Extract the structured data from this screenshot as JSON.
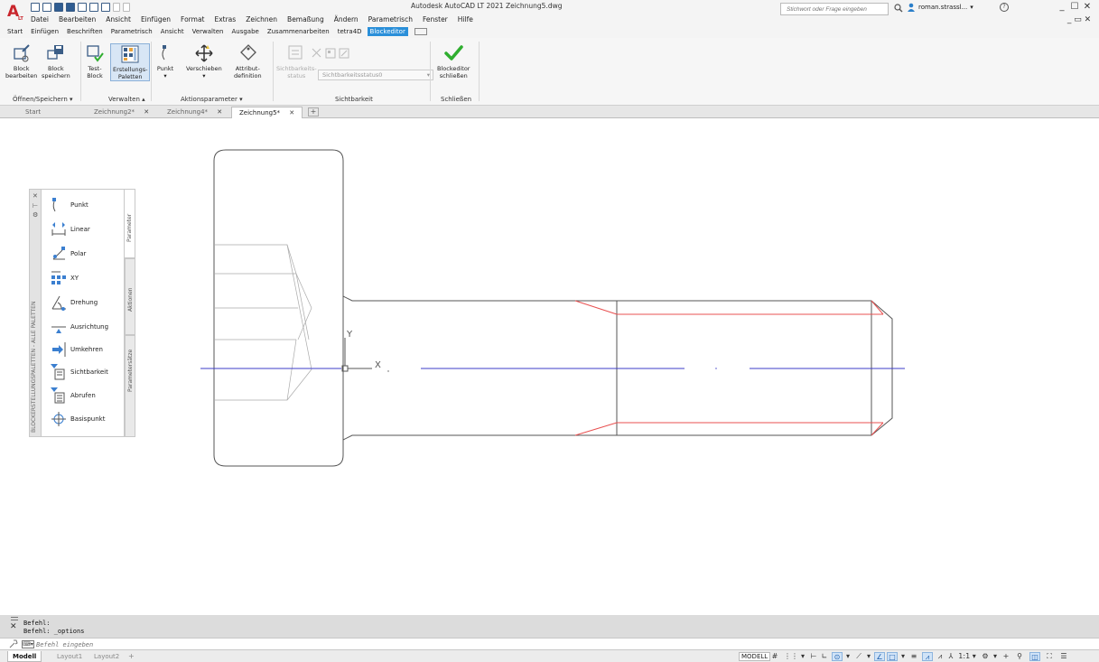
{
  "app": {
    "title": "Autodesk AutoCAD LT 2021  Zeichnung5.dwg",
    "logo_letter": "A",
    "logo_sub": "LT"
  },
  "menubar": [
    "Datei",
    "Bearbeiten",
    "Ansicht",
    "Einfügen",
    "Format",
    "Extras",
    "Zeichnen",
    "Bemaßung",
    "Ändern",
    "Parametrisch",
    "Fenster",
    "Hilfe"
  ],
  "search": {
    "placeholder": "Stichwort oder Frage eingeben"
  },
  "user": {
    "name": "roman.strassl..."
  },
  "help": {
    "label": "?"
  },
  "window_controls": {
    "minimize": "_",
    "maximize": "☐",
    "close": "✕",
    "doc_restore": "_ ▭ ✕"
  },
  "ribbon_tabs": [
    "Start",
    "Einfügen",
    "Beschriften",
    "Parametrisch",
    "Ansicht",
    "Verwalten",
    "Ausgabe",
    "Zusammenarbeiten",
    "tetra4D",
    "Blockeditor"
  ],
  "ribbon_active_tab": "Blockeditor",
  "ribbon": {
    "panels": [
      {
        "title": "Öffnen/Speichern ▾"
      },
      {
        "title": "Verwalten ▴"
      },
      {
        "title": "Aktionsparameter ▾"
      },
      {
        "title": "Sichtbarkeit"
      },
      {
        "title": "Schließen"
      }
    ],
    "tools": {
      "block_bearbeiten": "Block\nbearbeiten",
      "block_speichern": "Block\nspeichern",
      "test_block": "Test-\nBlock",
      "erstellungs_paletten": "Erstellungs-\nPaletten",
      "punkt": "Punkt",
      "punkt_more": "▾",
      "verschieben": "Verschieben",
      "verschieben_more": "▾",
      "attribut_definition": "Attribut-\ndefinition",
      "sichtbarkeits_status": "Sichtbarkeits-\nstatus",
      "blockeditor_schliessen": "Blockeditor\nschließen"
    },
    "visibility_select": "Sichtbarkeitsstatus0"
  },
  "doc_tabs": [
    {
      "label": "Start",
      "active": false,
      "closable": false
    },
    {
      "label": "Zeichnung2*",
      "active": false,
      "closable": true
    },
    {
      "label": "Zeichnung4*",
      "active": false,
      "closable": true
    },
    {
      "label": "Zeichnung5*",
      "active": true,
      "closable": true
    }
  ],
  "doc_tab_close": "✕",
  "doc_tab_new": "+",
  "palette": {
    "title": "BLOCKERSTELLUNGSPALETTEN - ALLE PALETTEN",
    "controls": [
      "✕",
      "⊢",
      "⚙"
    ],
    "items": [
      "Punkt",
      "Linear",
      "Polar",
      "XY",
      "Drehung",
      "Ausrichtung",
      "Umkehren",
      "Sichtbarkeit",
      "Abrufen",
      "Basispunkt"
    ],
    "tabs": [
      "Parameter",
      "Aktionen",
      "Parametersätze"
    ]
  },
  "drawing": {
    "ucs_y": "Y",
    "ucs_x": "X"
  },
  "command": {
    "history": [
      "Befehl:",
      "Befehl: _options"
    ],
    "placeholder": "Befehl eingeben",
    "close": "✕",
    "prompt_btn": "⌨▾"
  },
  "status": {
    "layout_tabs": [
      "Modell",
      "Layout1",
      "Layout2"
    ],
    "layout_add": "+",
    "model_label": "MODELL",
    "scale_label": "1:1 ▾"
  },
  "colors": {
    "accent": "#2a8fd9",
    "logo": "#c9252c",
    "outline": "#555555",
    "red_lines": "#e85050",
    "blue_line": "#3c3cc8",
    "check": "#2fae2f"
  }
}
